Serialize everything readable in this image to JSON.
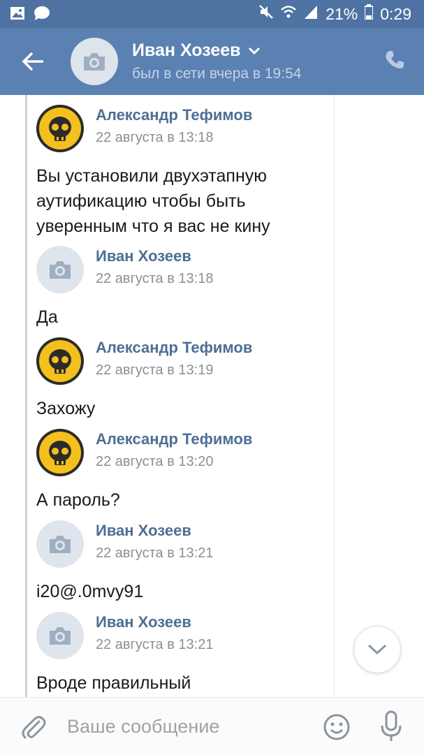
{
  "status_bar": {
    "battery": "21%",
    "time": "0:29",
    "icons": [
      "image-icon",
      "chat-bubble-icon",
      "mute-icon",
      "wifi-icon",
      "signal-icon",
      "battery-icon"
    ]
  },
  "header": {
    "name": "Иван Хозеев",
    "status": "был в сети вчера в 19:54",
    "icons": [
      "back-arrow-icon",
      "camera-icon",
      "chevron-down-icon",
      "phone-icon"
    ]
  },
  "messages": [
    {
      "author": "Александр Тефимов",
      "date": "22 августа в 13:18",
      "text": "Вы установили двухэтапную аутификацию чтобы быть уверенным что я вас не кину",
      "avatar": "skull-icon"
    },
    {
      "author": "Иван Хозеев",
      "date": "22 августа в 13:18",
      "text": "Да",
      "avatar": "camera-icon"
    },
    {
      "author": "Александр Тефимов",
      "date": "22 августа в 13:19",
      "text": "Захожу",
      "avatar": "skull-icon"
    },
    {
      "author": "Александр Тефимов",
      "date": "22 августа в 13:20",
      "text": "А пароль?",
      "avatar": "skull-icon"
    },
    {
      "author": "Иван Хозеев",
      "date": "22 августа в 13:21",
      "text": "i20@.0mvy91",
      "avatar": "camera-icon"
    },
    {
      "author": "Иван Хозеев",
      "date": "22 августа в 13:21",
      "text": "Вроде правильный",
      "avatar": "camera-icon"
    }
  ],
  "composer": {
    "placeholder": "Ваше сообщение",
    "icons": [
      "paperclip-icon",
      "emoji-icon",
      "microphone-icon"
    ]
  },
  "colors": {
    "header": "#5b81b3",
    "status_bar": "#4e72a1",
    "author": "#4e6f94",
    "thread_line": "#c9d3de"
  }
}
